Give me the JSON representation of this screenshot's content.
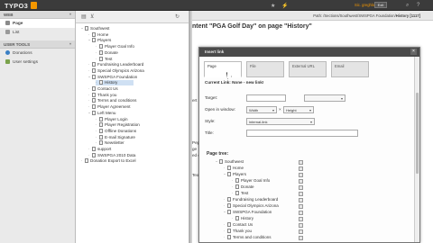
{
  "topbar": {
    "logo": "TYPO3",
    "user": "Sic. greghlohe",
    "exit_label": "Exit"
  },
  "left_panel": {
    "web_section": "WEB",
    "web_items": [
      {
        "label": "Page",
        "icon": "page-icon",
        "active": true
      },
      {
        "label": "List",
        "icon": "list-icon",
        "active": false
      }
    ],
    "user_section": "USER TOOLS",
    "user_items": [
      {
        "label": "Donations",
        "icon": "donations-icon"
      },
      {
        "label": "User settings",
        "icon": "user-settings-icon"
      }
    ]
  },
  "page_tree": {
    "nodes": [
      {
        "label": "Southwest",
        "depth": 0,
        "expanded": true
      },
      {
        "label": "Home",
        "depth": 1
      },
      {
        "label": "Players",
        "depth": 1,
        "expanded": true
      },
      {
        "label": "Player Goal Info",
        "depth": 2
      },
      {
        "label": "Donate",
        "depth": 2
      },
      {
        "label": "Test",
        "depth": 2
      },
      {
        "label": "Fundraising Leaderboard",
        "depth": 1
      },
      {
        "label": "Special Olympics Arizona",
        "depth": 1
      },
      {
        "label": "SWSPGA Foundation",
        "depth": 1,
        "expanded": true
      },
      {
        "label": "History",
        "depth": 2,
        "selected": true
      },
      {
        "label": "Contact Us",
        "depth": 1
      },
      {
        "label": "Thank you",
        "depth": 1
      },
      {
        "label": "Terms and conditions",
        "depth": 1
      },
      {
        "label": "Player Agreement",
        "depth": 1
      },
      {
        "label": "Left Menu",
        "depth": 1,
        "expanded": true
      },
      {
        "label": "Player Login",
        "depth": 2
      },
      {
        "label": "Player Registration",
        "depth": 2
      },
      {
        "label": "Offline Donations",
        "depth": 2
      },
      {
        "label": "E-mail Signature",
        "depth": 2
      },
      {
        "label": "Newsletter",
        "depth": 2
      },
      {
        "label": "support",
        "depth": 1
      },
      {
        "label": "SWSPGA 2010 Data",
        "depth": 1
      },
      {
        "label": "Donation Export to Excel",
        "depth": 0
      }
    ]
  },
  "content": {
    "path_prefix": "Path: /Sections/Southwest/SWSPGA Foundation/",
    "path_page": "History [1117]",
    "heading": "ntent \"PGA Golf Day\" on page \"History\"",
    "bg_fragments": [
      "ert",
      "Pepa",
      "ge",
      "ed o",
      "Text"
    ]
  },
  "modal": {
    "title": "Insert link",
    "close": "×",
    "tabs": [
      "Page",
      "File",
      "External URL",
      "Email"
    ],
    "current_link": "Current Link: None - new link!",
    "target_label": "Target:",
    "open_label": "Open in window:",
    "width_value": "Width",
    "height_value": "Height",
    "style_label": "Style:",
    "style_value": "internal-link",
    "title_label": "Title:",
    "page_tree_label": "Page tree:",
    "tree": [
      {
        "label": "Southwest",
        "depth": 0,
        "expanded": true
      },
      {
        "label": "Home",
        "depth": 1
      },
      {
        "label": "Players",
        "depth": 1,
        "expanded": true
      },
      {
        "label": "Player Goal Info",
        "depth": 2
      },
      {
        "label": "Donate",
        "depth": 2
      },
      {
        "label": "Test",
        "depth": 2
      },
      {
        "label": "Fundraising Leaderboard",
        "depth": 1
      },
      {
        "label": "Special Olympics Arizona",
        "depth": 1
      },
      {
        "label": "SWSPGA Foundation",
        "depth": 1,
        "expanded": true
      },
      {
        "label": "History",
        "depth": 2
      },
      {
        "label": "Contact Us",
        "depth": 1
      },
      {
        "label": "Thank you",
        "depth": 1
      },
      {
        "label": "Terms and conditions",
        "depth": 1
      }
    ]
  }
}
